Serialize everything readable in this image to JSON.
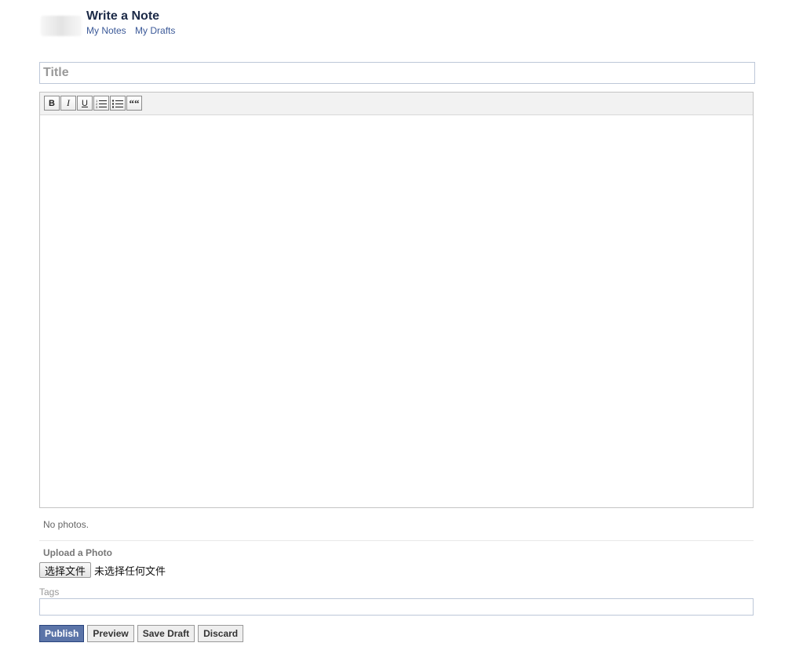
{
  "header": {
    "title": "Write a Note",
    "nav": [
      "My Notes",
      "My Drafts"
    ]
  },
  "title_field": {
    "placeholder": "Title",
    "value": ""
  },
  "toolbar": {
    "bold": "B",
    "italic": "I",
    "underline": "U",
    "quote": "““"
  },
  "photos": {
    "status": "No photos.",
    "upload_label": "Upload a Photo",
    "choose_file": "选择文件",
    "no_file": "未选择任何文件"
  },
  "tags": {
    "label": "Tags",
    "value": ""
  },
  "actions": {
    "publish": "Publish",
    "preview": "Preview",
    "save_draft": "Save Draft",
    "discard": "Discard"
  },
  "colors": {
    "link": "#3b5998",
    "title": "#1c2a47",
    "primary_button": "#5b74a8",
    "input_border": "#bdc7d8"
  }
}
